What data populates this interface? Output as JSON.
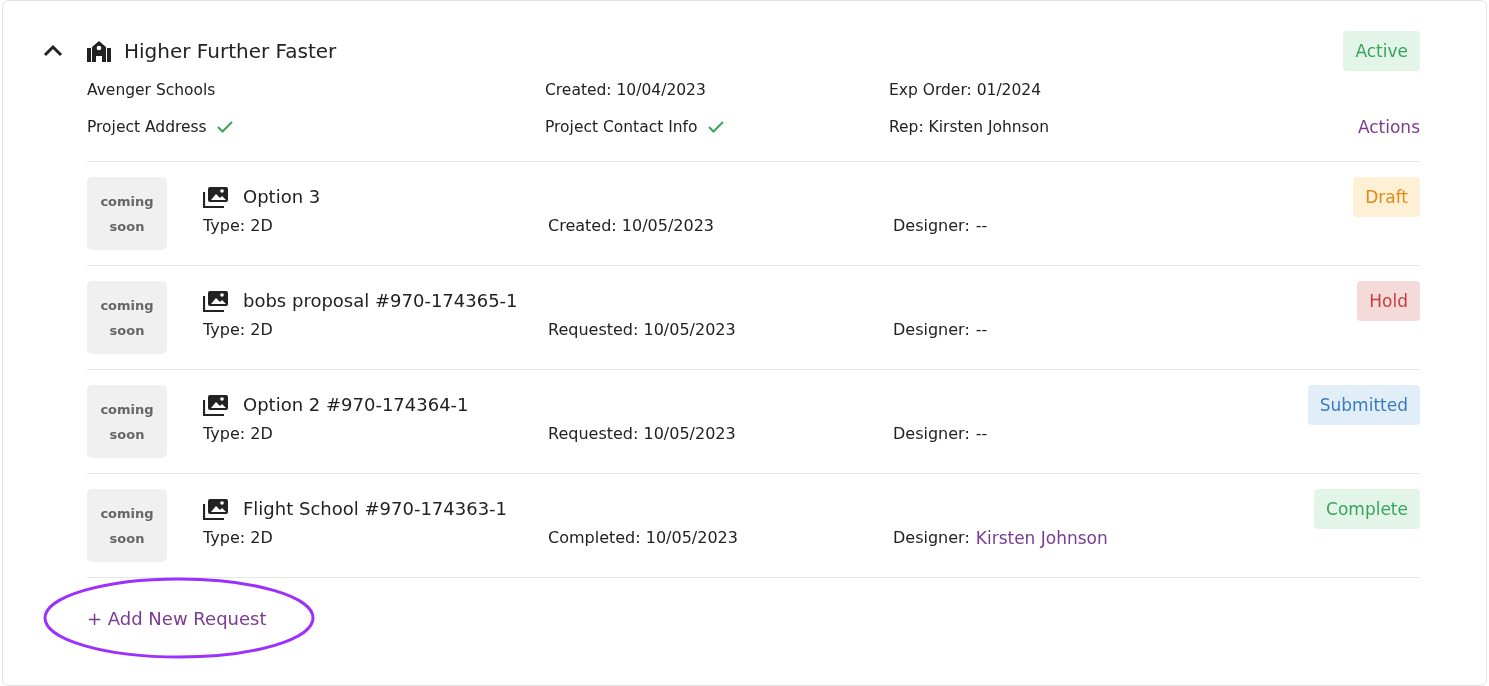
{
  "project": {
    "title": "Higher Further Faster",
    "expanded": true,
    "status": {
      "label": "Active",
      "kind": "active"
    },
    "client": "Avenger Schools",
    "created": "Created: 10/04/2023",
    "exp_order": "Exp Order: 01/2024",
    "checks": [
      {
        "label": "Project Address",
        "checked": true
      },
      {
        "label": "Project Contact Info",
        "checked": true
      }
    ],
    "rep": "Rep: Kirsten Johnson",
    "actions": "Actions"
  },
  "requests": [
    {
      "thumbnail": "coming soon",
      "title": "Option 3",
      "type": "Type: 2D",
      "date": "Created: 10/05/2023",
      "designer_label": "Designer:",
      "designer": "--",
      "designer_linked": false,
      "status": {
        "label": "Draft",
        "kind": "draft"
      }
    },
    {
      "thumbnail": "coming soon",
      "title": "bobs proposal #970-174365-1",
      "type": "Type: 2D",
      "date": "Requested: 10/05/2023",
      "designer_label": "Designer:",
      "designer": "--",
      "designer_linked": false,
      "status": {
        "label": "Hold",
        "kind": "hold"
      }
    },
    {
      "thumbnail": "coming soon",
      "title": "Option 2 #970-174364-1",
      "type": "Type: 2D",
      "date": "Requested: 10/05/2023",
      "designer_label": "Designer:",
      "designer": "--",
      "designer_linked": false,
      "status": {
        "label": "Submitted",
        "kind": "submitted"
      }
    },
    {
      "thumbnail": "coming soon",
      "title": "Flight School #970-174363-1",
      "type": "Type: 2D",
      "date": "Completed: 10/05/2023",
      "designer_label": "Designer:",
      "designer": "Kirsten Johnson",
      "designer_linked": true,
      "status": {
        "label": "Complete",
        "kind": "complete"
      }
    }
  ],
  "add_request": {
    "label": "+ Add New Request",
    "highlighted": true
  }
}
